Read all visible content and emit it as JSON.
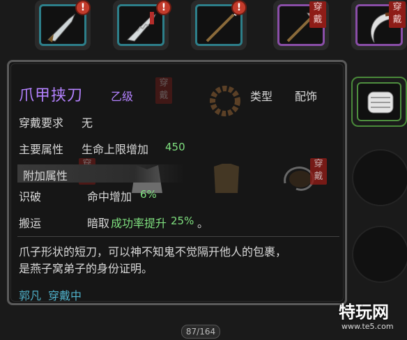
{
  "top_slots": [
    {
      "badge": "!",
      "icon": "curved-blade-icon",
      "wear": ""
    },
    {
      "badge": "!",
      "icon": "serrated-blade-icon",
      "wear": ""
    },
    {
      "badge": "!",
      "icon": "spear-icon",
      "wear": ""
    },
    {
      "badge": "",
      "icon": "halberd-icon",
      "wear": "穿戴"
    },
    {
      "badge": "",
      "icon": "crescent-blade-icon",
      "wear": "穿戴"
    }
  ],
  "item_panel": {
    "name": "爪甲挟刀",
    "rank": "乙级",
    "type_label": "类型",
    "type_value": "配饰",
    "wear_req_label": "穿戴要求",
    "wear_req_value": "无",
    "main_attr_label": "主要属性",
    "main_attr_text": "生命上限增加",
    "main_attr_value": "450",
    "extra_attr_label": "附加属性",
    "extra1_label": "识破",
    "extra1_text": "命中增加",
    "extra1_value": "6%",
    "extra2_label": "搬运",
    "extra2_prefix": "暗取",
    "extra2_highlight": "成功率提升",
    "extra2_value": "25%",
    "extra2_suffix": "。",
    "desc_line1": "爪子形状的短刀，可以神不知鬼不觉隔开他人的包裹，",
    "desc_line2": "是燕子窝弟子的身份证明。",
    "owner": "郭凡",
    "owner_status": "穿戴中"
  },
  "bg_wear_badges": [
    "穿戴",
    "穿戴",
    "穿戴"
  ],
  "inventory_counter": "87/164",
  "watermark": {
    "brand": "特玩网",
    "url": "www.te5.com"
  },
  "colors": {
    "purple": "#b482ff",
    "green": "#7fe07f",
    "cyan": "#4fb0c9",
    "teal_border": "#2d7f8a",
    "purple_border": "#8a4ea8",
    "wear_red": "#8e1c17"
  }
}
